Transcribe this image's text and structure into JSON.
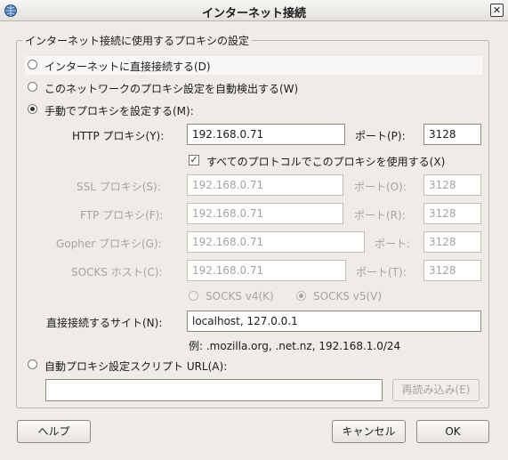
{
  "window": {
    "title": "インターネット接続",
    "close_glyph": "✕",
    "icon": "globe-icon"
  },
  "group": {
    "legend": "インターネット接続に使用するプロキシの設定"
  },
  "options": {
    "direct": "インターネットに直接接続する(D)",
    "auto_detect": "このネットワークのプロキシ設定を自動検出する(W)",
    "manual": "手動でプロキシを設定する(M):",
    "selected": "manual"
  },
  "http": {
    "label": "HTTP プロキシ(Y):",
    "host": "192.168.0.71",
    "port_label": "ポート(P):",
    "port": "3128"
  },
  "use_all": {
    "label": "すべてのプロトコルでこのプロキシを使用する(X)",
    "checked": true
  },
  "ssl": {
    "label": "SSL プロキシ(S):",
    "host": "192.168.0.71",
    "port_label": "ポート(O):",
    "port": "3128"
  },
  "ftp": {
    "label": "FTP プロキシ(F):",
    "host": "192.168.0.71",
    "port_label": "ポート(R):",
    "port": "3128"
  },
  "gopher": {
    "label": "Gopher プロキシ(G):",
    "host": "192.168.0.71",
    "port_label": "ポート:",
    "port": "3128"
  },
  "socks": {
    "label": "SOCKS ホスト(C):",
    "host": "192.168.0.71",
    "port_label": "ポート(T):",
    "port": "3128"
  },
  "socks_version": {
    "v4": "SOCKS v4(K)",
    "v5": "SOCKS v5(V)",
    "selected": "v5"
  },
  "no_proxy": {
    "label": "直接接続するサイト(N):",
    "value": "localhost, 127.0.0.1",
    "example": "例: .mozilla.org, .net.nz, 192.168.1.0/24"
  },
  "auto_config": {
    "label": "自動プロキシ設定スクリプト URL(A):",
    "url": "",
    "reload": "再読み込み(E)"
  },
  "buttons": {
    "help": "ヘルプ",
    "cancel": "キャンセル",
    "ok": "OK"
  }
}
